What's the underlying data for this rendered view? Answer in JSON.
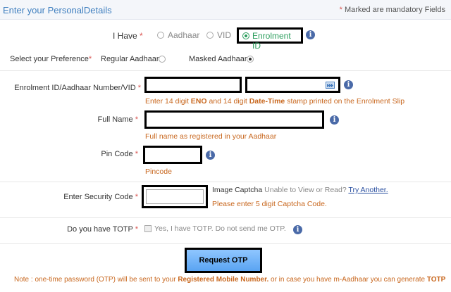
{
  "header": {
    "title": "Enter your PersonalDetails",
    "mandatory_star": "*",
    "mandatory_note": "Marked are mandatory Fields"
  },
  "i_have": {
    "label": "I Have",
    "star": "*",
    "options": [
      "Aadhaar",
      "VID",
      "Enrolment ID"
    ],
    "selected": "Enrolment ID"
  },
  "preference": {
    "label": "Select your Preference",
    "star": "*",
    "options": [
      "Regular Aadhaar",
      "Masked Aadhaar"
    ],
    "selected": "Masked Aadhaar"
  },
  "enrolment": {
    "label": "Enrolment ID/Aadhaar Number/VID",
    "star": "*",
    "eno_value": "",
    "datetime_value": "",
    "hint_1": "Enter 14 digit ",
    "hint_2": "ENO",
    "hint_3": " and 14 digit ",
    "hint_4": "Date-Time",
    "hint_5": " stamp printed on the Enrolment Slip"
  },
  "full_name": {
    "label": "Full Name",
    "star": "*",
    "value": "",
    "hint": "Full name as registered in your Aadhaar"
  },
  "pin_code": {
    "label": "Pin Code",
    "star": "*",
    "value": "",
    "hint": "Pincode"
  },
  "security": {
    "label": "Enter Security Code",
    "star": "*",
    "value": "",
    "captcha_label": "Image Captcha",
    "unable_text": "Unable to View or Read?",
    "try_another": "Try Another.",
    "hint": "Please enter 5 digit Captcha Code."
  },
  "totp": {
    "label": "Do you have TOTP",
    "star": "*",
    "checkbox_label": "Yes, I have TOTP. Do not send me OTP.",
    "checked": false
  },
  "submit": {
    "label": "Request OTP"
  },
  "note": {
    "part_1": "Note : one-time password (OTP) will be sent to your ",
    "part_2": "Registered Mobile Number.",
    "part_3": " or in case you have m-Aadhaar you can generate ",
    "part_4": "TOTP"
  },
  "info_icon_glyph": "i",
  "colors": {
    "accent_blue": "#3f7fbf",
    "hint_orange": "#c8671e",
    "required_red": "#d9534f",
    "selected_green": "#2a9d5c",
    "button_blue": "#6fb3f8"
  }
}
